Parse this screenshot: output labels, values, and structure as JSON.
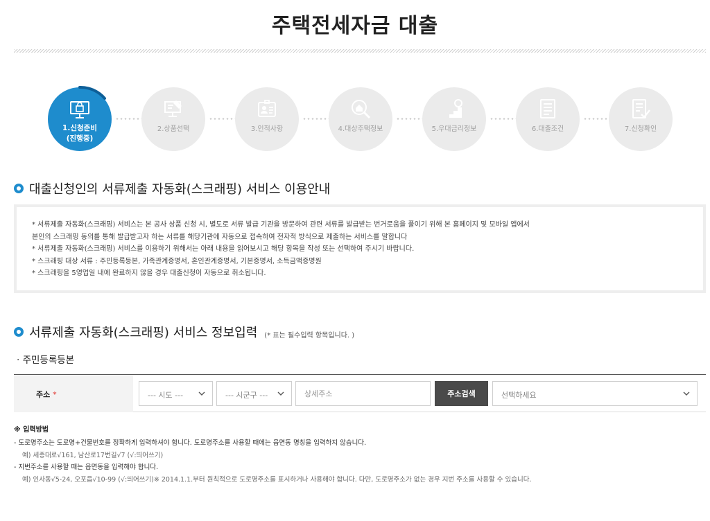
{
  "page": {
    "title": "주택전세자금 대출"
  },
  "steps": [
    {
      "label": "1.신청준비",
      "sub": "(진행중)",
      "icon": "monitor-lock-icon",
      "active": true
    },
    {
      "label": "2.상품선택",
      "sub": "",
      "icon": "product-select-icon",
      "active": false
    },
    {
      "label": "3.인적사항",
      "sub": "",
      "icon": "id-card-icon",
      "active": false
    },
    {
      "label": "4.대상주택정보",
      "sub": "",
      "icon": "house-search-icon",
      "active": false
    },
    {
      "label": "5.우대금리정보",
      "sub": "",
      "icon": "rate-stairs-icon",
      "active": false
    },
    {
      "label": "6.대출조건",
      "sub": "",
      "icon": "document-list-icon",
      "active": false
    },
    {
      "label": "7.신청확인",
      "sub": "",
      "icon": "document-check-icon",
      "active": false
    }
  ],
  "guide": {
    "heading": "대출신청인의 서류제출 자동화(스크래핑) 서비스 이용안내",
    "lines": [
      "* 서류제출 자동화(스크래핑) 서비스는 본 공사 상품 신청 시, 별도로 서류 발급 기관을 방문하여 관련 서류를 발급받는 번거로움을 풀이기 위해 본 홈페이지 및 모바일 앱에서",
      "   본인의 스크래핑 동의를 통해 발급받고자 하는 서류를 해당기관에 자동으로 접속하여 전자적 방식으로 제출하는 서비스를 말합니다",
      "* 서류제출 자동화(스크래핑) 서비스를 이용하기 위해서는 아래 내용을 읽어보시고 해당 항목을 작성 또는 선택하여 주시기 바랍니다.",
      "* 스크래핑 대상 서류 : 주민등록등본, 가족관계증명서, 혼인관계증명서, 기본증명서, 소득금액증명원",
      "* 스크래핑을 5영업일 내에 완료하지 않을 경우 대출신청이 자동으로 취소됩니다."
    ]
  },
  "info_input": {
    "heading": "서류제출 자동화(스크래핑) 서비스 정보입력",
    "note": "(* 표는 필수입력 항목입니다. )",
    "subheading": "· 주민등록등본"
  },
  "address": {
    "label": "주소",
    "required_mark": "*",
    "sido": "--- 시도 ---",
    "sigungu": "--- 시군구 ---",
    "detail_placeholder": "상세주소",
    "search_button": "주소검색",
    "result_select": "선택하세요"
  },
  "method": {
    "title": "※ 입력방법",
    "lines": [
      {
        "text": "- 도로명주소는 도로명+건물번호를 정확하게 입력하셔야 합니다. 도로명주소를 사용할 때에는 읍면동 명칭을 입력하지 않습니다.",
        "example": false
      },
      {
        "text": "예) 세종대로√161, 남산로17번길√7 (√:띄어쓰기)",
        "example": true
      },
      {
        "text": "- 지번주소를 사용할 때는 읍면동을 입력해야 합니다.",
        "example": false
      },
      {
        "text": "예) 인사동√5-24, 오포읍√10-99 (√:띄어쓰기)※ 2014.1.1.부터 원칙적으로 도로명주소를 표시하거나 사용해야 합니다. 다만, 도로명주소가 없는 경우 지번 주소를 사용할 수 있습니다.",
        "example": true
      }
    ]
  },
  "colors": {
    "accent": "#1e8ccd",
    "inactive_step": "#ebebeb",
    "button_dark": "#4a4a4a",
    "required": "#e0312b"
  }
}
